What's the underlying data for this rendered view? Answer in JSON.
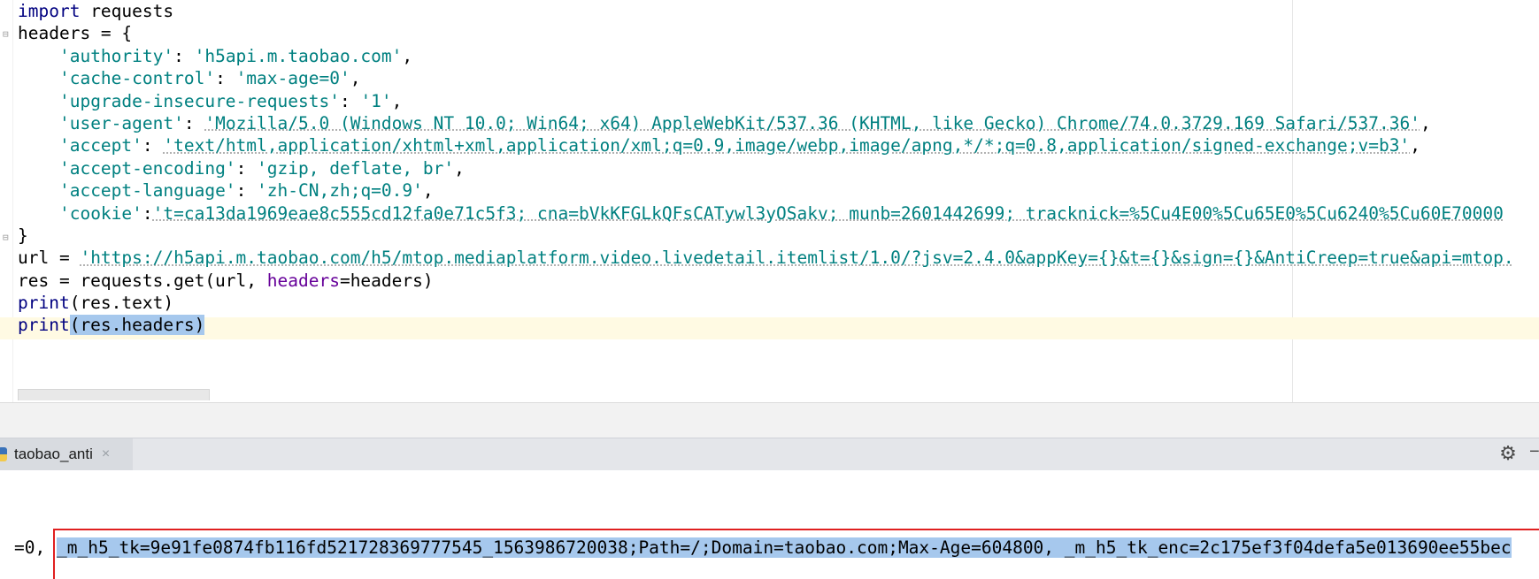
{
  "editor": {
    "lines": [
      [
        {
          "t": "import",
          "c": "kw"
        },
        {
          "t": " requests"
        }
      ],
      [
        {
          "t": "headers = {"
        }
      ],
      [
        {
          "t": "    "
        },
        {
          "t": "'authority'",
          "c": "str"
        },
        {
          "t": ": "
        },
        {
          "t": "'h5api.m.taobao.com'",
          "c": "str"
        },
        {
          "t": ","
        }
      ],
      [
        {
          "t": "    "
        },
        {
          "t": "'cache-control'",
          "c": "str"
        },
        {
          "t": ": "
        },
        {
          "t": "'max-age=0'",
          "c": "str"
        },
        {
          "t": ","
        }
      ],
      [
        {
          "t": "    "
        },
        {
          "t": "'upgrade-insecure-requests'",
          "c": "str"
        },
        {
          "t": ": "
        },
        {
          "t": "'1'",
          "c": "str"
        },
        {
          "t": ","
        }
      ],
      [
        {
          "t": "    "
        },
        {
          "t": "'user-agent'",
          "c": "str"
        },
        {
          "t": ": "
        },
        {
          "t": "'Mozilla/5.0 (Windows NT 10.0; Win64; x64) AppleWebKit/537.36 (KHTML, like Gecko) Chrome/74.0.3729.169 Safari/537.36'",
          "c": "str-u"
        },
        {
          "t": ","
        }
      ],
      [
        {
          "t": "    "
        },
        {
          "t": "'accept'",
          "c": "str"
        },
        {
          "t": ": "
        },
        {
          "t": "'text/html,application/xhtml+xml,application/xml;q=0.9,image/webp,image/apng,*/*;q=0.8,application/signed-exchange;v=b3'",
          "c": "str-u"
        },
        {
          "t": ","
        }
      ],
      [
        {
          "t": "    "
        },
        {
          "t": "'accept-encoding'",
          "c": "str"
        },
        {
          "t": ": "
        },
        {
          "t": "'gzip, deflate, br'",
          "c": "str"
        },
        {
          "t": ","
        }
      ],
      [
        {
          "t": "    "
        },
        {
          "t": "'accept-language'",
          "c": "str"
        },
        {
          "t": ": "
        },
        {
          "t": "'zh-CN,zh;q=0.9'",
          "c": "str"
        },
        {
          "t": ","
        }
      ],
      [
        {
          "t": "    "
        },
        {
          "t": "'cookie'",
          "c": "str"
        },
        {
          "t": ":"
        },
        {
          "t": "'t=ca13da1969eae8c555cd12fa0e71c5f3; cna=bVkKFGLkQFsCATywl3yOSakv; munb=2601442699; tracknick=%5Cu4E00%5Cu65E0%5Cu6240%5Cu60E70000",
          "c": "str-u"
        }
      ],
      [
        {
          "t": "}"
        }
      ],
      [
        {
          "t": "url = "
        },
        {
          "t": "'https://h5api.m.taobao.com/h5/mtop.mediaplatform.video.livedetail.itemlist/1.0/?jsv=2.4.0&appKey={}&t={}&sign={}&AntiCreep=true&api=mtop.",
          "c": "str-u"
        }
      ],
      [
        {
          "t": "res = requests.get(url, "
        },
        {
          "t": "headers",
          "c": "param"
        },
        {
          "t": "=headers)"
        }
      ],
      [
        {
          "t": "print",
          "c": "builtin"
        },
        {
          "t": "(res.text)"
        }
      ],
      [
        {
          "t": "print",
          "c": "builtin"
        },
        {
          "t": "(res.headers)",
          "c": "sel"
        }
      ]
    ]
  },
  "run_panel": {
    "tab_label": "taobao_anti",
    "close_glyph": "×",
    "settings_icon": "gear-icon",
    "minimize_glyph": "−"
  },
  "console": {
    "prefix": "=0, ",
    "output": "_m_h5_tk=9e91fe0874fb116fd521728369777545_1563986720038;Path=/;Domain=taobao.com;Max-Age=604800, _m_h5_tk_enc=2c175ef3f04defa5e013690ee55bec"
  },
  "colors": {
    "keyword": "#000080",
    "string": "#008080",
    "param": "#660099",
    "selection": "#a6c8ed",
    "highlight_box": "#e02020"
  }
}
